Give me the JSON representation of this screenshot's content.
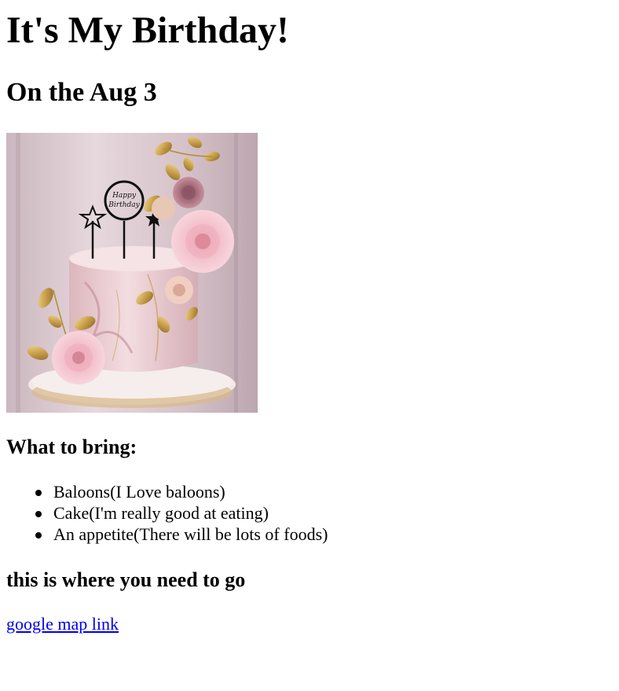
{
  "header": {
    "title": "It's My Birthday!",
    "date": "On the Aug 3"
  },
  "image": {
    "topper_text": "Happy Birthday",
    "colors": {
      "background": "#d9c9cf",
      "cake": "#efd6d8",
      "rose": "#f2b8c3",
      "gold": "#c9a04a"
    }
  },
  "bring": {
    "heading": "What to bring:",
    "items": [
      "Baloons(I Love baloons)",
      "Cake(I'm really good at eating)",
      "An appetite(There will be lots of foods)"
    ]
  },
  "directions": {
    "heading": "this is where you need to go",
    "link_label": "google map link",
    "link_color": "#0000ee"
  }
}
